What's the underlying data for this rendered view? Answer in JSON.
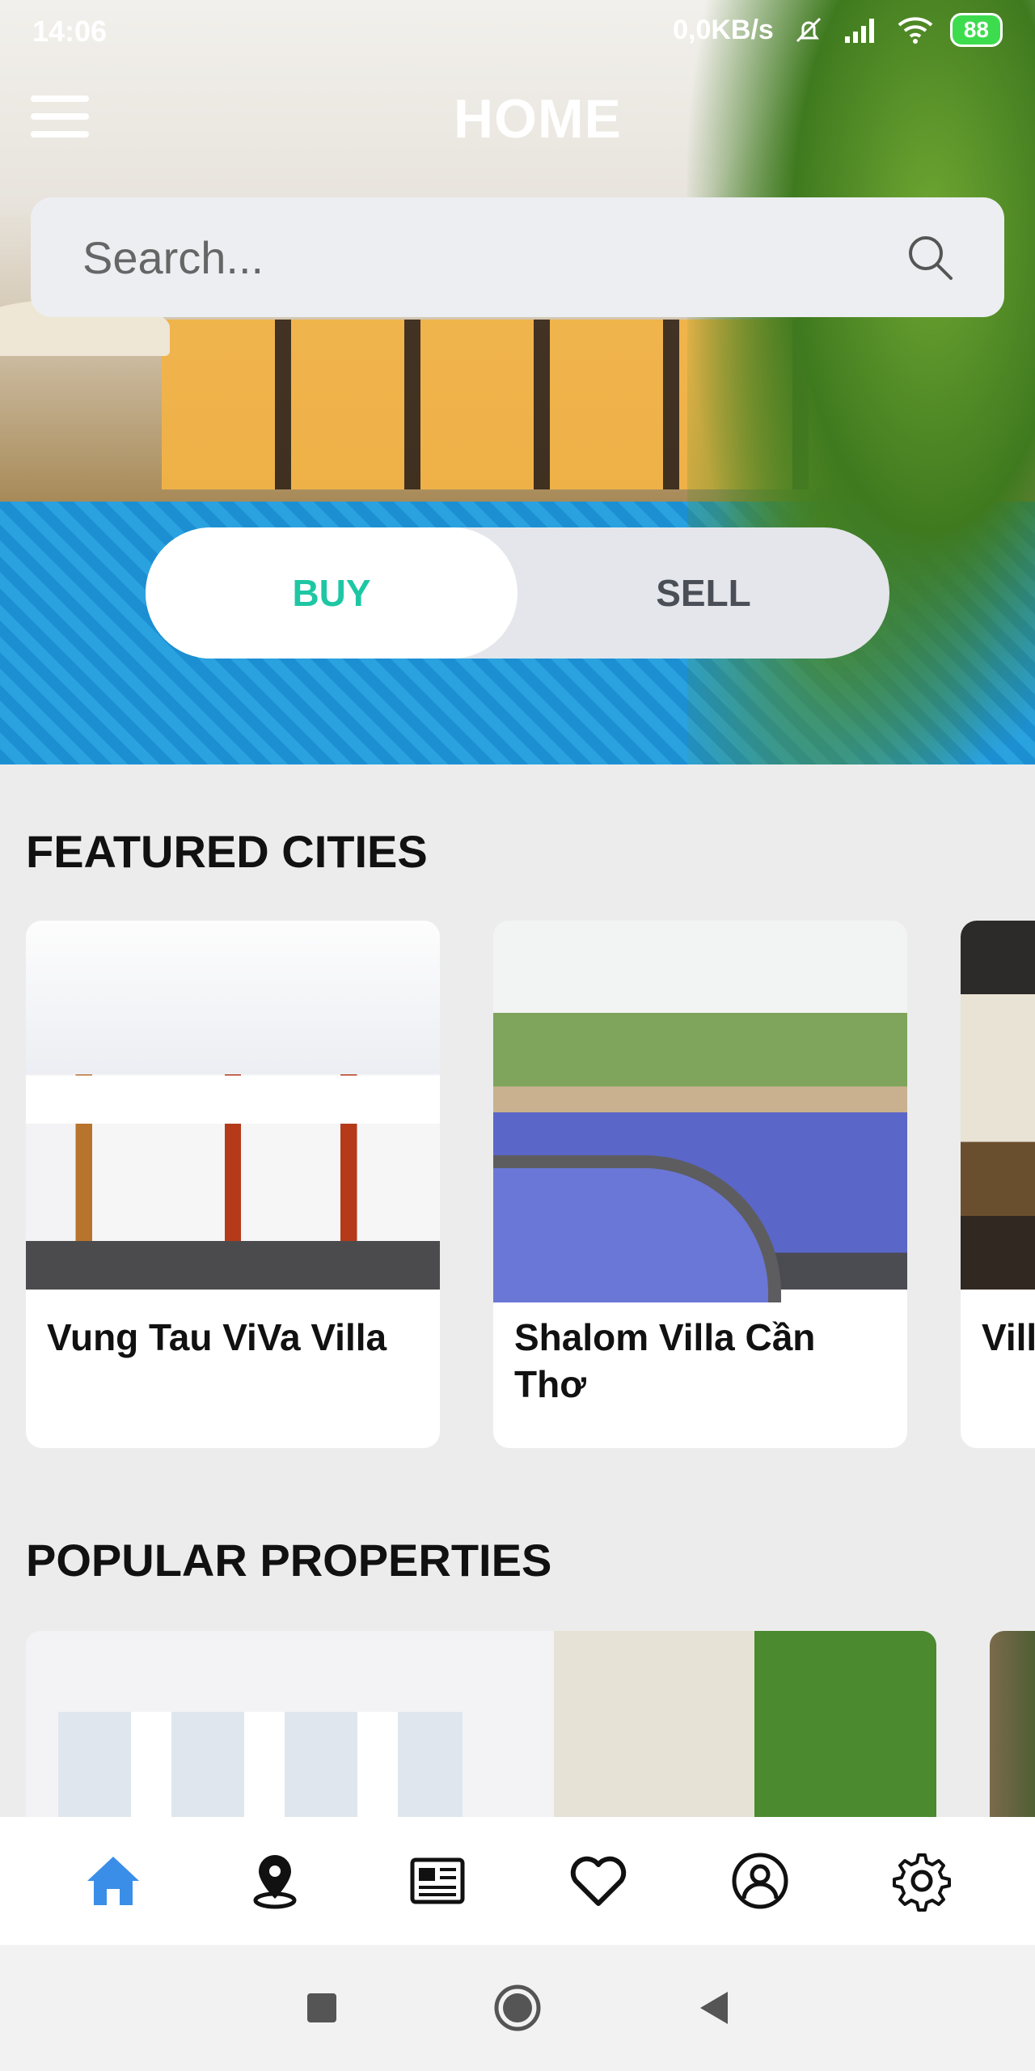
{
  "status_bar": {
    "time": "14:06",
    "network_speed": "0,0KB/s",
    "battery": "88"
  },
  "header": {
    "title": "HOME",
    "menu_icon": "hamburger-menu-icon"
  },
  "search": {
    "placeholder": "Search...",
    "icon": "search-icon"
  },
  "mode_toggle": {
    "options": [
      "BUY",
      "SELL"
    ],
    "selected": "BUY",
    "active_color": "#1ec7a4"
  },
  "featured_cities": {
    "title": "FEATURED CITIES",
    "items": [
      {
        "name": "Vung Tau ViVa Villa"
      },
      {
        "name": "Shalom Villa Cần Thơ"
      },
      {
        "name": "Vill"
      }
    ]
  },
  "popular_properties": {
    "title": "POPULAR PROPERTIES"
  },
  "bottom_nav": {
    "items": [
      {
        "icon": "home-icon",
        "active": true
      },
      {
        "icon": "map-pin-icon",
        "active": false
      },
      {
        "icon": "news-icon",
        "active": false
      },
      {
        "icon": "heart-icon",
        "active": false
      },
      {
        "icon": "profile-icon",
        "active": false
      },
      {
        "icon": "gear-icon",
        "active": false
      }
    ],
    "active_color": "#3b8ee8"
  },
  "system_nav": {
    "buttons": [
      "recent-apps-icon",
      "home-circle-icon",
      "back-icon"
    ]
  }
}
